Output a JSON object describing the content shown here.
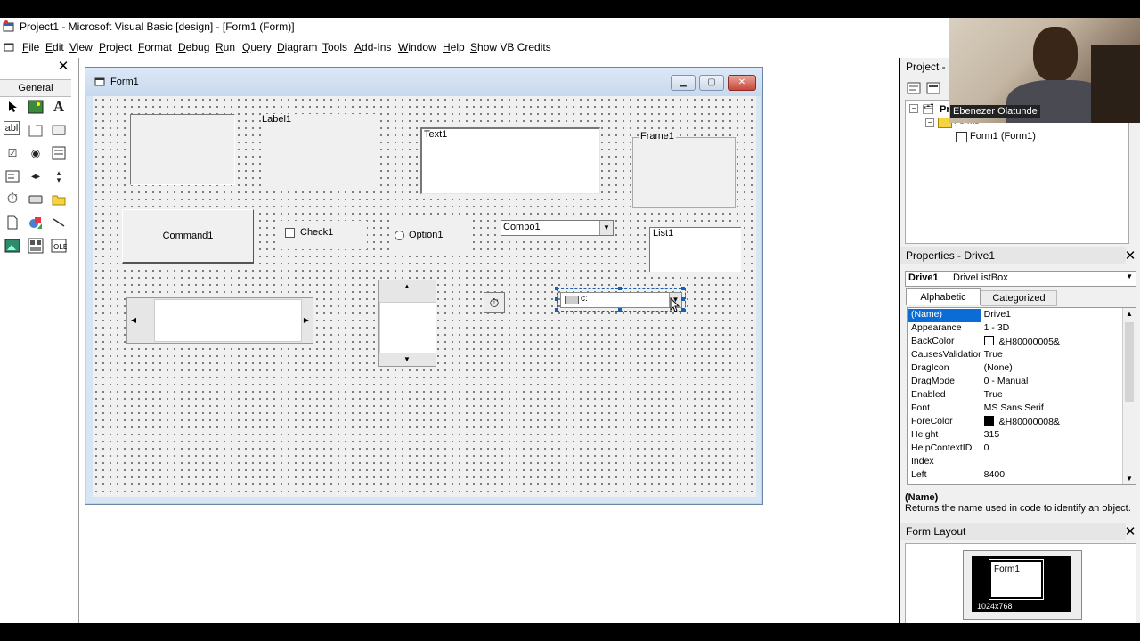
{
  "window": {
    "title": "Project1 - Microsoft Visual Basic [design] - [Form1 (Form)]"
  },
  "menu": [
    "File",
    "Edit",
    "View",
    "Project",
    "Format",
    "Debug",
    "Run",
    "Query",
    "Diagram",
    "Tools",
    "Add-Ins",
    "Window",
    "Help",
    "Show VB Credits"
  ],
  "toolbox": {
    "header": "General",
    "abc_label": "abl"
  },
  "form": {
    "caption": "Form1",
    "label1": "Label1",
    "text1": "Text1",
    "frame1": "Frame1",
    "command1": "Command1",
    "check1": "Check1",
    "option1": "Option1",
    "combo1": "Combo1",
    "list1": "List1",
    "drive1": "c:"
  },
  "project": {
    "header": "Project - P",
    "root": "Pr",
    "forms_folder": "Forms",
    "form_item": "Form1 (Form1)"
  },
  "webcam": {
    "name": "Ebenezer Olatunde"
  },
  "properties": {
    "header": "Properties - Drive1",
    "object": "Drive1",
    "object_type": "DriveListBox",
    "tab_alpha": "Alphabetic",
    "tab_cat": "Categorized",
    "rows": [
      {
        "name": "(Name)",
        "value": "Drive1"
      },
      {
        "name": "Appearance",
        "value": "1 - 3D"
      },
      {
        "name": "BackColor",
        "value": "&H80000005&"
      },
      {
        "name": "CausesValidation",
        "value": "True"
      },
      {
        "name": "DragIcon",
        "value": "(None)"
      },
      {
        "name": "DragMode",
        "value": "0 - Manual"
      },
      {
        "name": "Enabled",
        "value": "True"
      },
      {
        "name": "Font",
        "value": "MS Sans Serif"
      },
      {
        "name": "ForeColor",
        "value": "&H80000008&"
      },
      {
        "name": "Height",
        "value": "315"
      },
      {
        "name": "HelpContextID",
        "value": "0"
      },
      {
        "name": "Index",
        "value": ""
      },
      {
        "name": "Left",
        "value": "8400"
      }
    ],
    "desc_title": "(Name)",
    "desc_text": "Returns the name used in code to identify an object."
  },
  "form_layout": {
    "header": "Form Layout",
    "form_label": "Form1",
    "resolution": "1024x768"
  },
  "colors": {
    "selection": "#0a6cd4",
    "backcolor_swatch": "#ffffff",
    "forecolor_swatch": "#000000"
  }
}
